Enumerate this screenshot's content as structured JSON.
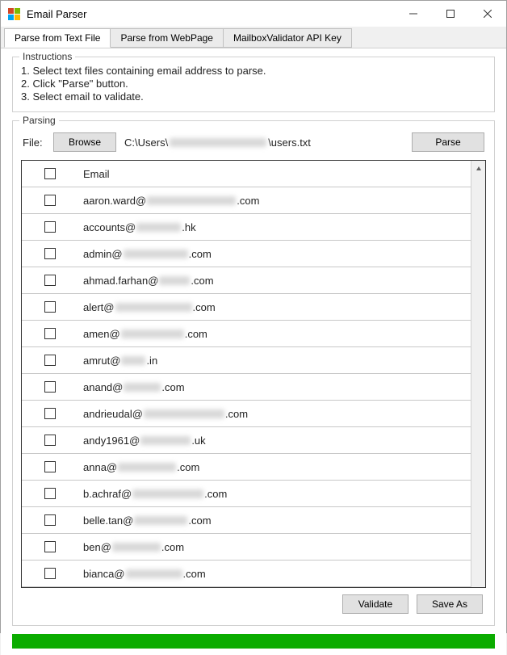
{
  "window": {
    "title": "Email Parser"
  },
  "tabs": [
    {
      "label": "Parse from Text File",
      "active": true
    },
    {
      "label": "Parse from WebPage",
      "active": false
    },
    {
      "label": "MailboxValidator API Key",
      "active": false
    }
  ],
  "instructions": {
    "legend": "Instructions",
    "lines": [
      "1. Select text files containing email address to parse.",
      "2. Click \"Parse\" button.",
      "3. Select email to validate."
    ]
  },
  "parsing": {
    "legend": "Parsing",
    "fileLabel": "File:",
    "browseLabel": "Browse",
    "parseLabel": "Parse",
    "filePathPrefix": "C:\\Users\\",
    "filePathSuffix": "\\users.txt",
    "emailHeader": "Email",
    "rows": [
      {
        "prefix": "aaron.ward@",
        "suffix": ".com",
        "blurw": 110
      },
      {
        "prefix": "accounts@",
        "suffix": ".hk",
        "blurw": 55
      },
      {
        "prefix": "admin@",
        "suffix": ".com",
        "blurw": 80
      },
      {
        "prefix": "ahmad.farhan@",
        "suffix": ".com",
        "blurw": 38
      },
      {
        "prefix": "alert@",
        "suffix": ".com",
        "blurw": 95
      },
      {
        "prefix": "amen@",
        "suffix": ".com",
        "blurw": 78
      },
      {
        "prefix": "amrut@",
        "suffix": ".in",
        "blurw": 30
      },
      {
        "prefix": "anand@",
        "suffix": ".com",
        "blurw": 46
      },
      {
        "prefix": "andrieudal@",
        "suffix": ".com",
        "blurw": 100
      },
      {
        "prefix": "andy1961@",
        "suffix": ".uk",
        "blurw": 62
      },
      {
        "prefix": "anna@",
        "suffix": ".com",
        "blurw": 72
      },
      {
        "prefix": "b.achraf@",
        "suffix": ".com",
        "blurw": 88
      },
      {
        "prefix": "belle.tan@",
        "suffix": ".com",
        "blurw": 66
      },
      {
        "prefix": "ben@",
        "suffix": ".com",
        "blurw": 60
      },
      {
        "prefix": "bianca@",
        "suffix": ".com",
        "blurw": 70
      }
    ]
  },
  "footer": {
    "validateLabel": "Validate",
    "saveAsLabel": "Save As"
  }
}
